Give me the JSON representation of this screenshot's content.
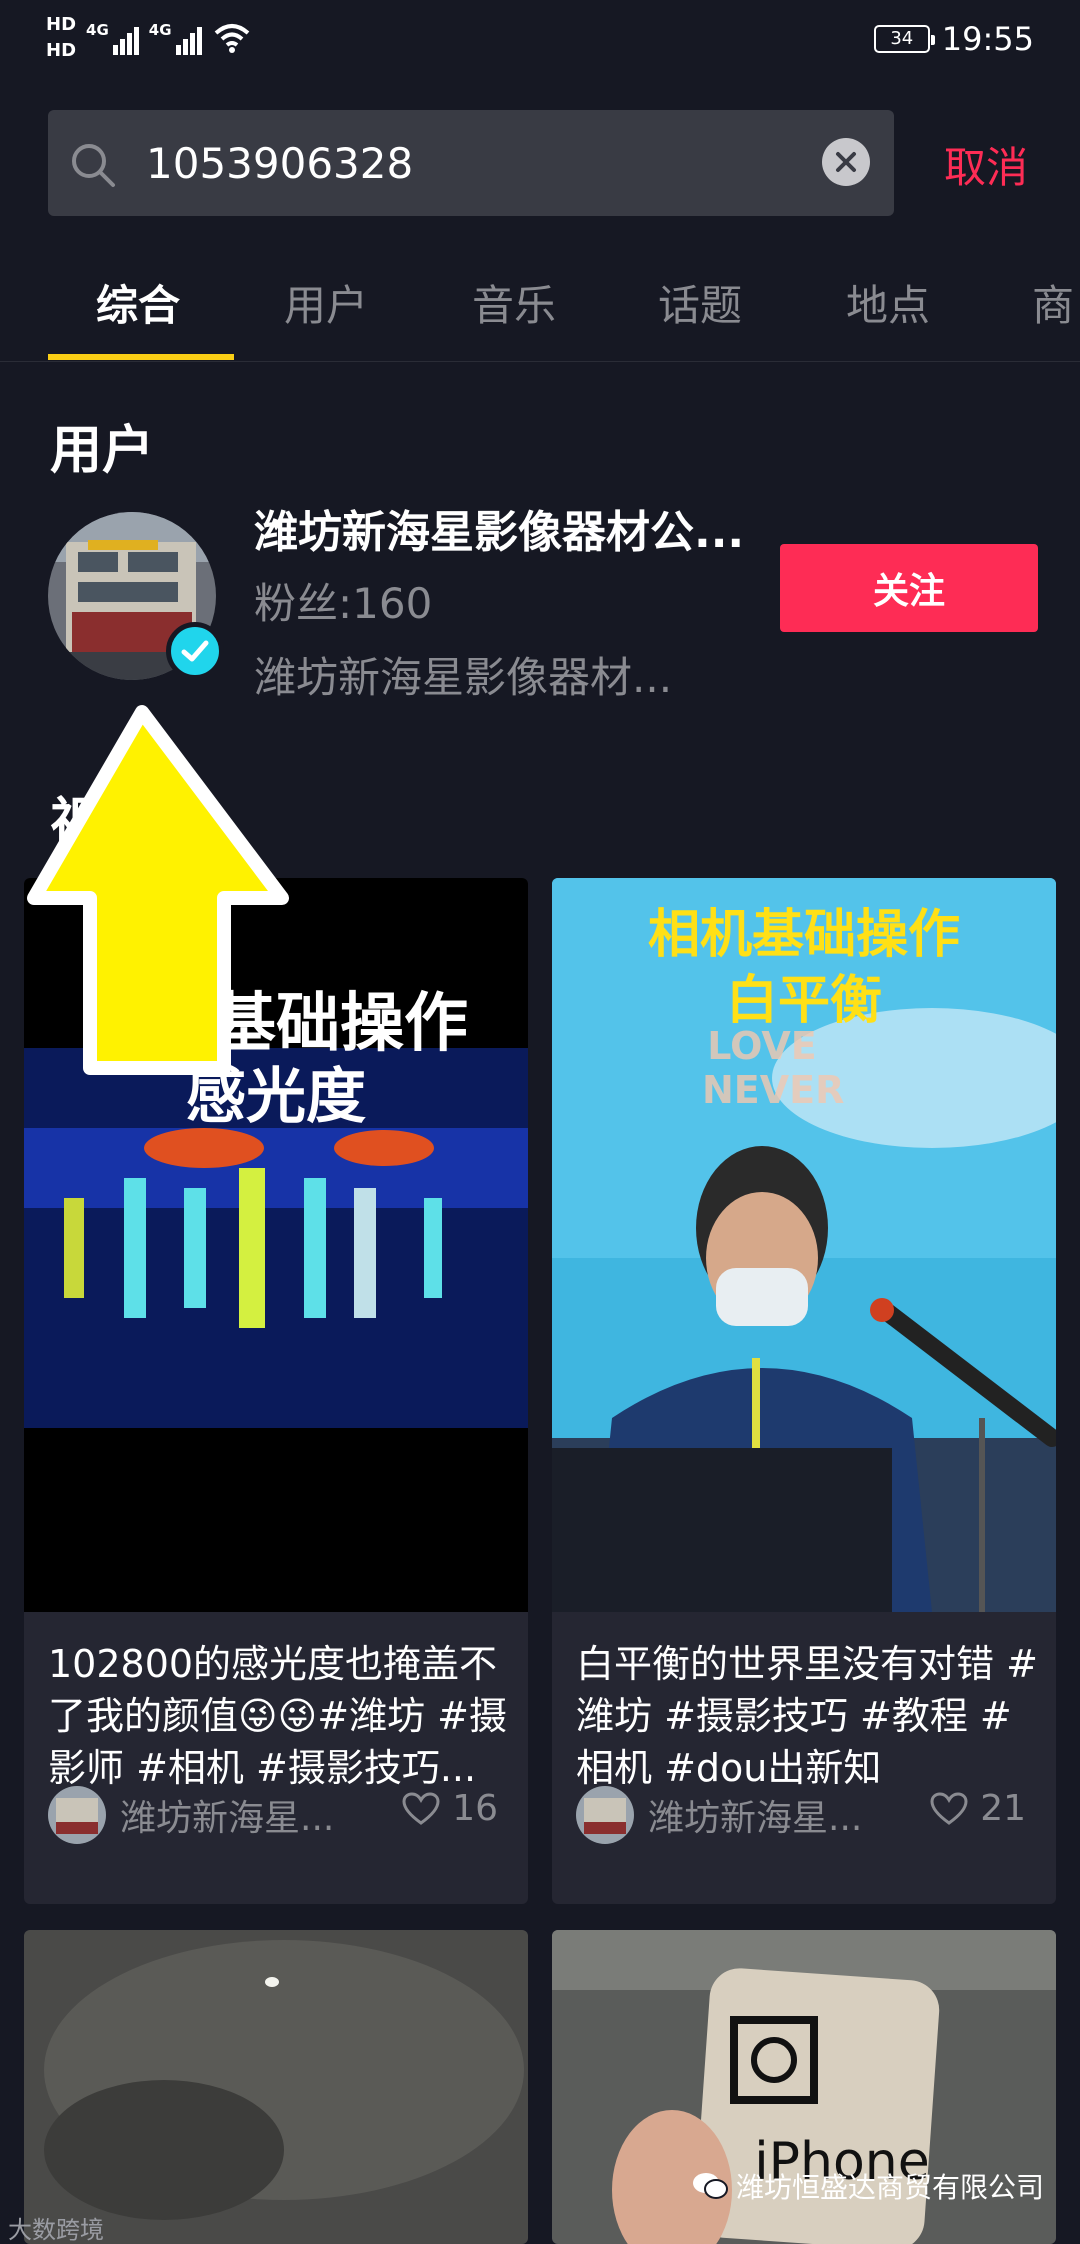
{
  "status_bar": {
    "hd1": "HD",
    "hd2": "HD",
    "net1": "4G",
    "net2": "4G",
    "battery": "34",
    "time": "19:55"
  },
  "search": {
    "value": "1053906328",
    "cancel_label": "取消"
  },
  "tabs": [
    "综合",
    "用户",
    "音乐",
    "话题",
    "地点",
    "商"
  ],
  "users_section": {
    "title": "用户",
    "user": {
      "name": "潍坊新海星影像器材公...",
      "fans": "粉丝:160",
      "desc": "潍坊新海星影像器材...",
      "follow_label": "关注"
    }
  },
  "videos_section": {
    "title_partial": "视"
  },
  "videos": [
    {
      "overlay_line1": "相机基础操作",
      "overlay_line2": "感光度",
      "desc": "102800的感光度也掩盖不了我的颜值😜😜#潍坊 #摄影师 #相机 #摄影技巧...",
      "author": "潍坊新海星...",
      "likes": "16"
    },
    {
      "overlay_line1": "相机基础操作",
      "overlay_line2": "白平衡",
      "bg_text": "LOVE NEVER",
      "desc": "白平衡的世界里没有对错 #潍坊 #摄影技巧 #教程 #相机 #dou出新知",
      "author": "潍坊新海星...",
      "likes": "21"
    },
    {
      "desc": "",
      "author": "",
      "likes": ""
    },
    {
      "phone_text": "iPhone",
      "desc": "",
      "author": "",
      "likes": ""
    }
  ],
  "watermarks": {
    "left": "大数跨境",
    "right": "潍坊恒盛达商贸有限公司"
  },
  "colors": {
    "background": "#161823",
    "accent_red": "#fe2c55",
    "tab_indicator": "#face15",
    "annotation_arrow": "#fff200",
    "muted_text": "#8a8b91"
  },
  "icons": [
    "search-icon",
    "clear-icon",
    "verified-icon",
    "heart-icon",
    "wechat-icon",
    "wifi-icon",
    "arrow-annotation"
  ]
}
